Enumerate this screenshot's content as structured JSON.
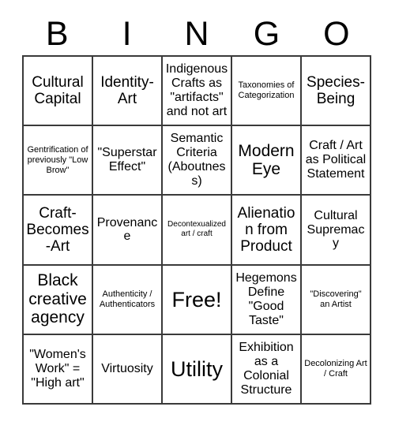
{
  "card": {
    "header_letters": [
      "B",
      "I",
      "N",
      "G",
      "O"
    ],
    "grid_size": 5,
    "free_space_label": "Free!",
    "free_space_index": 12,
    "border_color": "#3a3a3a",
    "background_color": "#ffffff",
    "text_color": "#000000"
  },
  "cells": [
    {
      "text": "Cultural Capital",
      "size": "fs-lg"
    },
    {
      "text": "Identity-Art",
      "size": "fs-lg"
    },
    {
      "text": "Indigenous Crafts as \"artifacts\" and not art",
      "size": "fs-md"
    },
    {
      "text": "Taxonomies of Categorization",
      "size": "fs-xs"
    },
    {
      "text": "Species-Being",
      "size": "fs-lg"
    },
    {
      "text": "Gentrification of previously \"Low Brow\"",
      "size": "fs-xs"
    },
    {
      "text": "\"Superstar Effect\"",
      "size": "fs-md"
    },
    {
      "text": "Semantic Criteria (Aboutness)",
      "size": "fs-md"
    },
    {
      "text": "Modern Eye",
      "size": "fs-xl"
    },
    {
      "text": "Craft / Art as Political Statement",
      "size": "fs-md"
    },
    {
      "text": "Craft-Becomes-Art",
      "size": "fs-lg"
    },
    {
      "text": "Provenance",
      "size": "fs-md"
    },
    {
      "text": "Decontexualized art / craft",
      "size": "fs-xxs"
    },
    {
      "text": "Alienation from Product",
      "size": "fs-lg"
    },
    {
      "text": "Cultural Supremacy",
      "size": "fs-md"
    },
    {
      "text": "Black creative agency",
      "size": "fs-xl"
    },
    {
      "text": "Authenticity / Authenticators",
      "size": "fs-xs"
    },
    {
      "text": "Free!",
      "size": "fs-xxl"
    },
    {
      "text": "Hegemons Define \"Good Taste\"",
      "size": "fs-md"
    },
    {
      "text": "\"Discovering\" an Artist",
      "size": "fs-xs"
    },
    {
      "text": "\"Women's Work\" = \"High art\"",
      "size": "fs-md"
    },
    {
      "text": "Virtuosity",
      "size": "fs-md"
    },
    {
      "text": "Utility",
      "size": "fs-xxl"
    },
    {
      "text": "Exhibition as a Colonial Structure",
      "size": "fs-md"
    },
    {
      "text": "Decolonizing Art / Craft",
      "size": "fs-xs"
    }
  ]
}
